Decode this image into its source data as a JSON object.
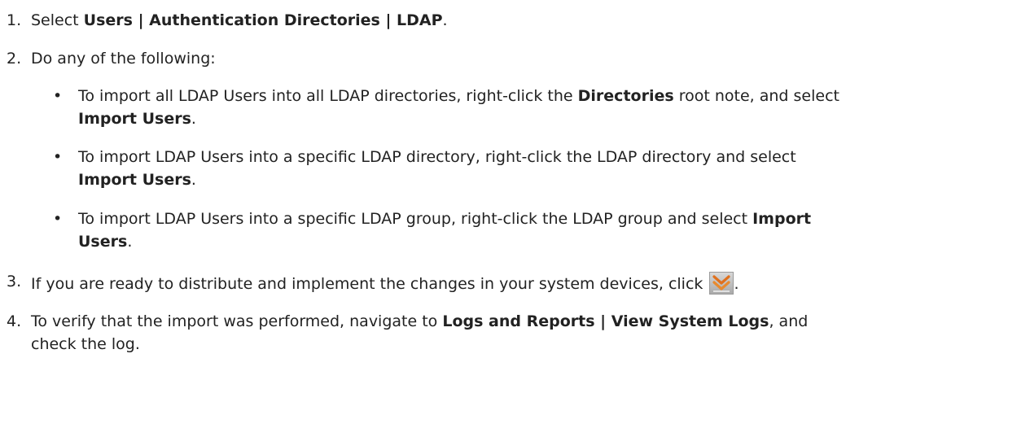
{
  "steps": [
    {
      "num": "1.",
      "pre": "Select ",
      "bold": "Users | Authentication Directories | LDAP",
      "post": "."
    },
    {
      "num": "2.",
      "text": "Do any of the following:"
    },
    {
      "num": "3.",
      "text": "If you are ready to distribute and implement the changes in your system devices, click ",
      "icon": "deploy-changes-icon",
      "post": "."
    },
    {
      "num": "4.",
      "pre": "To verify that the import was performed, navigate to ",
      "bold": "Logs and Reports | View System Logs",
      "post": ", and",
      "line2": "check the log."
    }
  ],
  "bullets": [
    {
      "symbol": "•",
      "pre": "To import all LDAP Users into all LDAP directories, right-click the ",
      "bold1": "Directories",
      "mid": " root note, and select",
      "bold2": "Import Users",
      "post": "."
    },
    {
      "symbol": "•",
      "pre": "To import LDAP Users into a specific LDAP directory, right-click the LDAP directory and select",
      "bold": "Import Users",
      "post": "."
    },
    {
      "symbol": "•",
      "pre": "To import LDAP Users into a specific LDAP group, right-click the LDAP group and select ",
      "bold1": "Import",
      "bold2": "Users",
      "post": "."
    }
  ]
}
